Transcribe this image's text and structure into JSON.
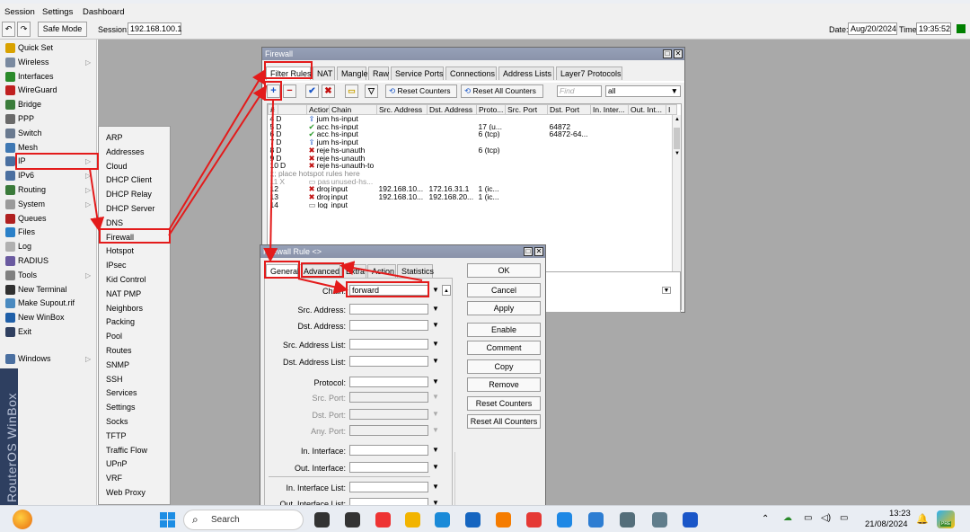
{
  "menubar": {
    "items": [
      "Session",
      "Settings",
      "Dashboard"
    ]
  },
  "toolbar": {
    "undo_icon": "undo-icon",
    "redo_icon": "redo-icon",
    "safe_mode_label": "Safe Mode",
    "session_label": "Session:",
    "session_value": "192.168.100.1",
    "date_label": "Date:",
    "date_value": "Aug/20/2024",
    "time_label": "Time:",
    "time_value": "19:35:52",
    "status_color": "#008000"
  },
  "sidebar": {
    "items": [
      {
        "label": "Quick Set",
        "icon": "quickset-icon",
        "color": "#d9a200",
        "arrow": ""
      },
      {
        "label": "Wireless",
        "icon": "wireless-icon",
        "color": "#7a8aa0",
        "arrow": "▷"
      },
      {
        "label": "Interfaces",
        "icon": "interfaces-icon",
        "color": "#2a8a2a",
        "arrow": ""
      },
      {
        "label": "WireGuard",
        "icon": "wireguard-icon",
        "color": "#c02020",
        "arrow": ""
      },
      {
        "label": "Bridge",
        "icon": "bridge-icon",
        "color": "#3b7d3b",
        "arrow": ""
      },
      {
        "label": "PPP",
        "icon": "ppp-icon",
        "color": "#6a6a6a",
        "arrow": ""
      },
      {
        "label": "Switch",
        "icon": "switch-icon",
        "color": "#6a7a90",
        "arrow": ""
      },
      {
        "label": "Mesh",
        "icon": "mesh-icon",
        "color": "#3f78b3",
        "arrow": ""
      },
      {
        "label": "IP",
        "icon": "ip-icon",
        "color": "#4a6fa0",
        "arrow": "▷"
      },
      {
        "label": "IPv6",
        "icon": "ipv6-icon",
        "color": "#4a6fa0",
        "arrow": "▷"
      },
      {
        "label": "Routing",
        "icon": "routing-icon",
        "color": "#3a7a3a",
        "arrow": "▷"
      },
      {
        "label": "System",
        "icon": "system-icon",
        "color": "#9a9a9a",
        "arrow": "▷"
      },
      {
        "label": "Queues",
        "icon": "queues-icon",
        "color": "#b02020",
        "arrow": ""
      },
      {
        "label": "Files",
        "icon": "files-icon",
        "color": "#2a80c8",
        "arrow": ""
      },
      {
        "label": "Log",
        "icon": "log-icon",
        "color": "#b0b0b0",
        "arrow": ""
      },
      {
        "label": "RADIUS",
        "icon": "radius-icon",
        "color": "#6a5aa0",
        "arrow": ""
      },
      {
        "label": "Tools",
        "icon": "tools-icon",
        "color": "#808080",
        "arrow": "▷"
      },
      {
        "label": "New Terminal",
        "icon": "terminal-icon",
        "color": "#303030",
        "arrow": ""
      },
      {
        "label": "Make Supout.rif",
        "icon": "supout-icon",
        "color": "#4a8ac0",
        "arrow": ""
      },
      {
        "label": "New WinBox",
        "icon": "winbox-icon",
        "color": "#1f5fa8",
        "arrow": ""
      },
      {
        "label": "Exit",
        "icon": "exit-icon",
        "color": "#304060",
        "arrow": ""
      },
      {
        "label": "Windows",
        "icon": "windows-icon",
        "color": "#4a6fa0",
        "arrow": "▷"
      }
    ],
    "brand": "RouterOS WinBox"
  },
  "submenu": {
    "items": [
      "ARP",
      "Addresses",
      "Cloud",
      "DHCP Client",
      "DHCP Relay",
      "DHCP Server",
      "DNS",
      "Firewall",
      "Hotspot",
      "IPsec",
      "Kid Control",
      "NAT PMP",
      "Neighbors",
      "Packing",
      "Pool",
      "Routes",
      "SNMP",
      "SSH",
      "Services",
      "Settings",
      "Socks",
      "TFTP",
      "Traffic Flow",
      "UPnP",
      "VRF",
      "Web Proxy"
    ]
  },
  "firewall": {
    "title": "Firewall",
    "tabs": [
      "Filter Rules",
      "NAT",
      "Mangle",
      "Raw",
      "Service Ports",
      "Connections",
      "Address Lists",
      "Layer7 Protocols"
    ],
    "reset_counters": "Reset Counters",
    "reset_all_counters": "Reset All Counters",
    "find_placeholder": "Find",
    "filter_value": "all",
    "columns": [
      "#",
      "",
      "Action",
      "Chain",
      "Src. Address",
      "Dst. Address",
      "Proto...",
      "Src. Port",
      "Dst. Port",
      "In. Inter...",
      "Out. Int...",
      "I"
    ],
    "rows": [
      {
        "num": "4",
        "flag": "D",
        "action": "jump",
        "action_icon": "jump-icon",
        "chain": "hs-input",
        "src": "",
        "dst": "",
        "proto": "",
        "sport": "",
        "dport": "",
        "muted": false
      },
      {
        "num": "5",
        "flag": "D",
        "action": "acc...",
        "action_icon": "accept-icon",
        "chain": "hs-input",
        "src": "",
        "dst": "",
        "proto": "17 (u...",
        "sport": "",
        "dport": "64872",
        "muted": false
      },
      {
        "num": "6",
        "flag": "D",
        "action": "acc...",
        "action_icon": "accept-icon",
        "chain": "hs-input",
        "src": "",
        "dst": "",
        "proto": "6 (tcp)",
        "sport": "",
        "dport": "64872-64...",
        "muted": false
      },
      {
        "num": "7",
        "flag": "D",
        "action": "jump",
        "action_icon": "jump-icon",
        "chain": "hs-input",
        "src": "",
        "dst": "",
        "proto": "",
        "sport": "",
        "dport": "",
        "muted": false
      },
      {
        "num": "8",
        "flag": "D",
        "action": "reject",
        "action_icon": "reject-icon",
        "chain": "hs-unauth",
        "src": "",
        "dst": "",
        "proto": "6 (tcp)",
        "sport": "",
        "dport": "",
        "muted": false
      },
      {
        "num": "9",
        "flag": "D",
        "action": "reject",
        "action_icon": "reject-icon",
        "chain": "hs-unauth",
        "src": "",
        "dst": "",
        "proto": "",
        "sport": "",
        "dport": "",
        "muted": false
      },
      {
        "num": "10",
        "flag": "D",
        "action": "reject",
        "action_icon": "reject-icon",
        "chain": "hs-unauth-to",
        "src": "",
        "dst": "",
        "proto": "",
        "sport": "",
        "dport": "",
        "muted": false
      },
      {
        "comment": ";;; place hotspot rules here"
      },
      {
        "num": "11",
        "flag": "X",
        "action": "pas...",
        "action_icon": "passthrough-icon",
        "chain": "unused-hs...",
        "src": "",
        "dst": "",
        "proto": "",
        "sport": "",
        "dport": "",
        "muted": true
      },
      {
        "num": "12",
        "flag": "",
        "action": "drop",
        "action_icon": "drop-icon",
        "chain": "input",
        "src": "192.168.10...",
        "dst": "172.16.31.1",
        "proto": "1 (ic...",
        "sport": "",
        "dport": "",
        "muted": false
      },
      {
        "num": "13",
        "flag": "",
        "action": "drop",
        "action_icon": "drop-icon",
        "chain": "input",
        "src": "192.168.10...",
        "dst": "192.168.20...",
        "proto": "1 (ic...",
        "sport": "",
        "dport": "",
        "muted": false
      },
      {
        "num": "14",
        "flag": "",
        "action": "log",
        "action_icon": "log-icon",
        "chain": "input",
        "src": "",
        "dst": "",
        "proto": "",
        "sport": "",
        "dport": "",
        "muted": false
      }
    ]
  },
  "rule": {
    "title": "Firewall Rule <>",
    "tabs": [
      "General",
      "Advanced",
      "Extra",
      "Action",
      "Statistics"
    ],
    "chain_label": "Chain:",
    "chain_value": "forward",
    "fields": [
      "Src. Address:",
      "Dst. Address:",
      "Src. Address List:",
      "Dst. Address List:",
      "Protocol:",
      "Src. Port:",
      "Dst. Port:",
      "Any. Port:",
      "In. Interface:",
      "Out. Interface:",
      "In. Interface List:",
      "Out. Interface List:"
    ],
    "buttons": [
      "OK",
      "Cancel",
      "Apply",
      "Enable",
      "Comment",
      "Copy",
      "Remove",
      "Reset Counters",
      "Reset All Counters"
    ]
  },
  "taskbar": {
    "search_placeholder": "Search",
    "clock_time": "13:23",
    "clock_date": "21/08/2024",
    "badge": "PRE",
    "icons": [
      "widgets-icon",
      "start-icon",
      "search-icon",
      "app-icon-1",
      "terminal-app-icon",
      "chrome-icon",
      "file-explorer-icon",
      "edge-icon",
      "store-icon",
      "firefox-icon",
      "wps-icon",
      "remote-icon",
      "monitor-icon",
      "phone-icon",
      "settings-icon",
      "winbox-task-icon"
    ]
  },
  "accent": {
    "highlight_red": "#e31b1b",
    "title_bar": "#8a93aa"
  }
}
